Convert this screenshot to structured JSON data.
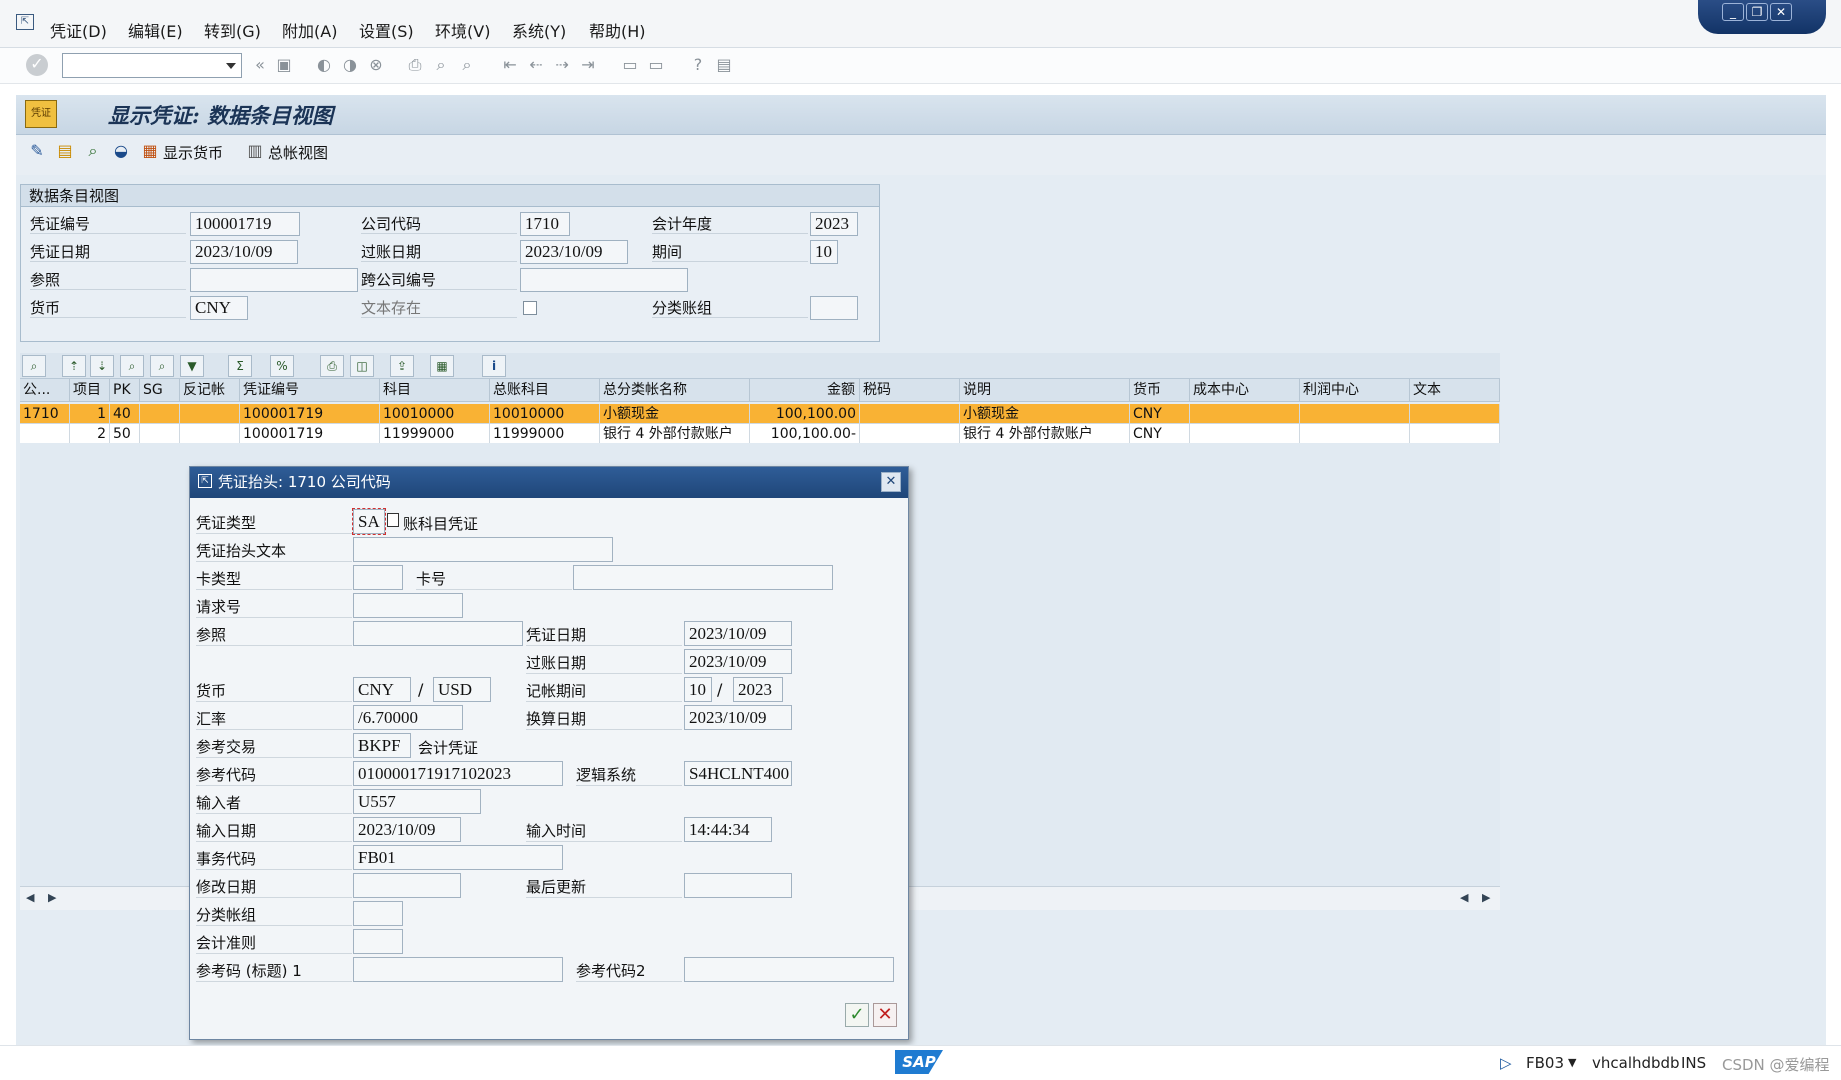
{
  "menu": [
    "凭证(D)",
    "编辑(E)",
    "转到(G)",
    "附加(A)",
    "设置(S)",
    "环境(V)",
    "系统(Y)",
    "帮助(H)"
  ],
  "page_title": "显示凭证: 数据条目视图",
  "app_toolbar": {
    "show_currency": "显示货币",
    "gl_view": "总帐视图"
  },
  "header": {
    "caption": "数据条目视图",
    "doc_no_label": "凭证编号",
    "doc_no": "100001719",
    "company_label": "公司代码",
    "company": "1710",
    "fiscal_year_label": "会计年度",
    "fiscal_year": "2023",
    "doc_date_label": "凭证日期",
    "doc_date": "2023/10/09",
    "posting_date_label": "过账日期",
    "posting_date": "2023/10/09",
    "period_label": "期间",
    "period": "10",
    "reference_label": "参照",
    "reference": "",
    "cross_cc_label": "跨公司编号",
    "cross_cc": "",
    "currency_label": "货币",
    "currency": "CNY",
    "text_exists_label": "文本存在",
    "ledger_group_label": "分类账组",
    "ledger_group": ""
  },
  "grid": {
    "columns": [
      "公...",
      "项目",
      "PK",
      "SG",
      "反记帐",
      "凭证编号",
      "科目",
      "总账科目",
      "总分类帐名称",
      "金额",
      "税码",
      "说明",
      "货币",
      "成本中心",
      "利润中心",
      "文本"
    ],
    "rows": [
      {
        "cc": "1710",
        "item": "1",
        "pk": "40",
        "sg": "",
        "rev": "",
        "doc": "100001719",
        "acct": "10010000",
        "gl": "10010000",
        "glname": "小额现金",
        "amount": "100,100.00",
        "tax": "",
        "desc": "小额现金",
        "cur": "CNY",
        "cost": "",
        "profit": "",
        "text": ""
      },
      {
        "cc": "",
        "item": "2",
        "pk": "50",
        "sg": "",
        "rev": "",
        "doc": "100001719",
        "acct": "11999000",
        "gl": "11999000",
        "glname": "银行 4 外部付款账户",
        "amount": "100,100.00-",
        "tax": "",
        "desc": "银行 4 外部付款账户",
        "cur": "CNY",
        "cost": "",
        "profit": "",
        "text": ""
      }
    ]
  },
  "dialog": {
    "title": "凭证抬头: 1710 公司代码",
    "doc_type_label": "凭证类型",
    "doc_type": "SA",
    "doc_type_desc": "账科目凭证",
    "header_text_label": "凭证抬头文本",
    "header_text": "",
    "card_type_label": "卡类型",
    "card_type": "",
    "card_no_label": "卡号",
    "card_no": "",
    "request_no_label": "请求号",
    "request_no": "",
    "reference_label": "参照",
    "reference": "",
    "doc_date_label": "凭证日期",
    "doc_date": "2023/10/09",
    "posting_date_label": "过账日期",
    "posting_date": "2023/10/09",
    "currency_label": "货币",
    "currency": "CNY",
    "currency2": "USD",
    "slash": "/",
    "period_label": "记帐期间",
    "period": "10",
    "period_year": "2023",
    "rate_label": "汇率",
    "rate": "/6.70000",
    "translation_date_label": "换算日期",
    "translation_date": "2023/10/09",
    "ref_trans_label": "参考交易",
    "ref_trans": "BKPF",
    "ref_trans_desc": "会计凭证",
    "ref_key_label": "参考代码",
    "ref_key": "010000171917102023",
    "logical_system_label": "逻辑系统",
    "logical_system": "S4HCLNT400",
    "entered_by_label": "输入者",
    "entered_by": "U557",
    "entry_date_label": "输入日期",
    "entry_date": "2023/10/09",
    "entry_time_label": "输入时间",
    "entry_time": "14:44:34",
    "tcode_label": "事务代码",
    "tcode": "FB01",
    "changed_on_label": "修改日期",
    "changed_on": "",
    "last_update_label": "最后更新",
    "last_update": "",
    "ledger_group_label": "分类帐组",
    "ledger_group": "",
    "acct_principle_label": "会计准则",
    "acct_principle": "",
    "ref_key1_label": "参考码 (标题) 1",
    "ref_key1": "",
    "ref_key2_label": "参考代码2",
    "ref_key2": ""
  },
  "status": {
    "tcode": "FB03",
    "host": "vhcalhdbdb",
    "mode": "INS",
    "watermark": "CSDN @爱编程"
  }
}
